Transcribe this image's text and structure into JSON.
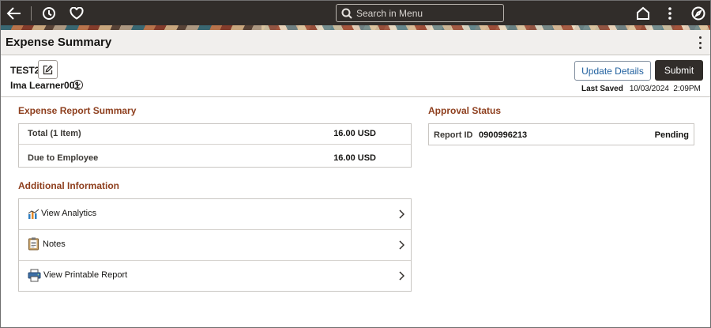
{
  "header": {
    "search_placeholder": "Search in Menu",
    "icons": [
      "back-arrow-icon",
      "history-clock-icon",
      "favorites-heart-icon",
      "home-icon",
      "actions-kebab-icon",
      "navbar-compass-icon"
    ]
  },
  "page": {
    "title": "Expense Summary"
  },
  "context": {
    "report_name": "TEST2",
    "user_name": "Ima Learner001",
    "update_button": "Update Details",
    "submit_button": "Submit",
    "last_saved_label": "Last Saved",
    "last_saved_value": "10/03/2024  2:09PM"
  },
  "summary": {
    "title": "Expense Report Summary",
    "rows": [
      {
        "label": "Total (1 Item)",
        "value": "16.00 USD"
      },
      {
        "label": "Due to Employee",
        "value": "16.00 USD"
      }
    ]
  },
  "additional": {
    "title": "Additional Information",
    "links": [
      {
        "label": "View Analytics",
        "icon": "analytics-chart-icon"
      },
      {
        "label": "Notes",
        "icon": "notes-clipboard-icon"
      },
      {
        "label": "View Printable Report",
        "icon": "printer-icon"
      }
    ]
  },
  "approval": {
    "title": "Approval Status",
    "report_id_label": "Report ID",
    "report_id_value": "0900996213",
    "status": "Pending"
  },
  "colors": {
    "banner": "#312d2a",
    "section_title": "#8e3f1e",
    "link_blue": "#1f5f9e",
    "submit_bg": "#312d2a"
  }
}
